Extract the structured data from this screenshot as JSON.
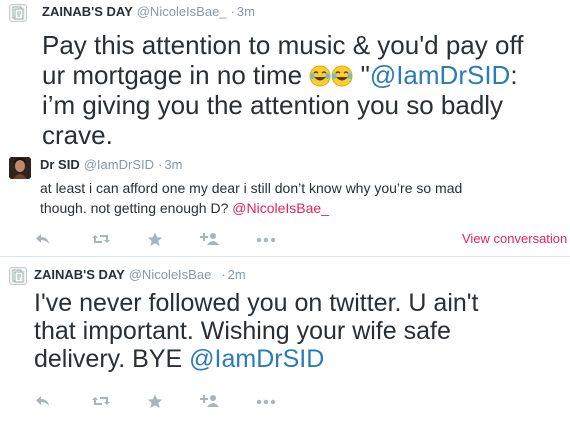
{
  "tweets": [
    {
      "name": "ZAINAB'S DAY",
      "handle": "@NicoleIsBae_",
      "dot": "·",
      "time": "3m",
      "text_line1": "Pay this attention to music & you'd pay off",
      "text_line2_a": "ur mortgage in no time ",
      "text_line2_emoji": "😂😂",
      "text_line2_b": " \"",
      "text_line2_mention": "@IamDrSID",
      "text_line2_c": ":",
      "text_line3": "i’m giving you the attention you so badly",
      "text_line4": "crave."
    },
    {
      "name": "Dr SID",
      "handle": "@IamDrSID",
      "dot": "·",
      "time": "3m",
      "text_line1": "at least i can afford one my dear i still don’t know why you’re so mad",
      "text_line2": "though. not getting enough D? ",
      "text_line2_mention": "@NicoleIsBae_",
      "view_conversation": "View conversation"
    },
    {
      "name": "ZAINAB'S DAY",
      "handle": "@NicoleIsBae",
      "dot": "·",
      "time": "2m",
      "text_line1": "I've never followed you on twitter. U ain't",
      "text_line2": "that important. Wishing your wife safe",
      "text_line3": "delivery. BYE ",
      "text_line3_mention": "@IamDrSID"
    }
  ],
  "icons": {
    "reply": "reply-icon",
    "retweet": "retweet-icon",
    "favorite": "star-icon",
    "follow": "follow-icon",
    "more": "more-icon"
  },
  "colors": {
    "link_blue": "#2b7bb9",
    "link_red": "#e0245e",
    "meta_gray": "#8899a6",
    "action_gray": "#a9b5bd",
    "text": "#292f33"
  }
}
